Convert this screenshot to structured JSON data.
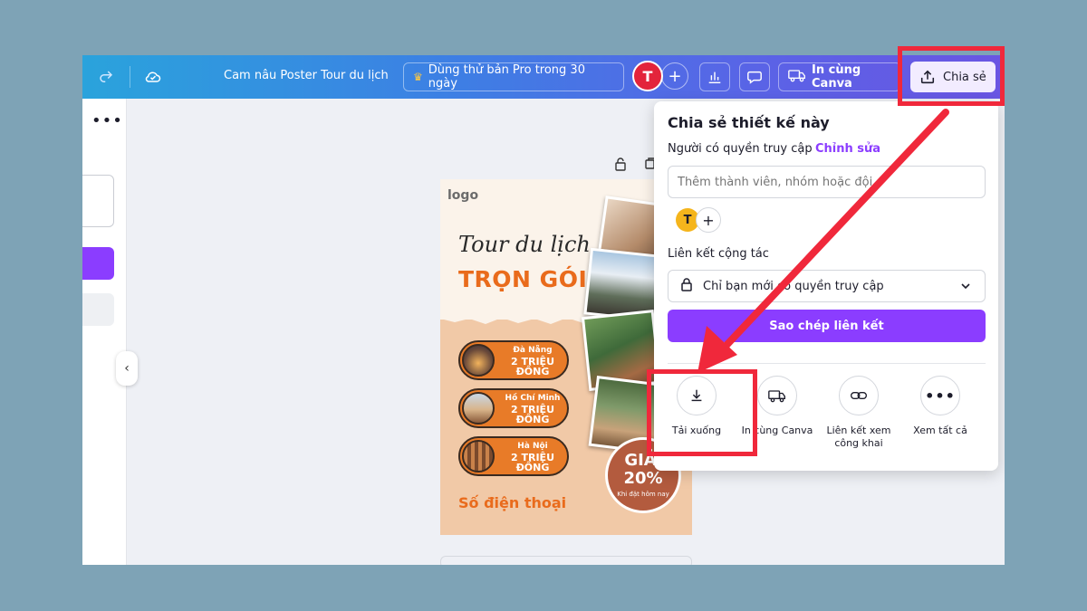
{
  "topbar": {
    "doc_title": "Cam nâu Poster Tour du lịch",
    "pro_trial": "Dùng thử bản Pro trong 30 ngày",
    "avatar_initial": "T",
    "add_symbol": "+",
    "print_label": "In cùng Canva",
    "share_label": "Chia sẻ"
  },
  "left_panel": {
    "more_symbol": "•••",
    "collapse_symbol": "‹"
  },
  "poster": {
    "logo": "logo",
    "headline_script": "Tour du lịch",
    "headline_bold": "TRỌN GÓI",
    "destinations": [
      {
        "city": "Đà Nẵng",
        "price": "2 TRIỆU ĐỒNG"
      },
      {
        "city": "Hồ Chí Minh",
        "price": "2 TRIỆU ĐỒNG"
      },
      {
        "city": "Hà Nội",
        "price": "2 TRIỆU ĐỒNG"
      }
    ],
    "sale_word": "GIẢM",
    "sale_percent": "20%",
    "sale_note": "Khi đặt hôm nay",
    "phone": "Số điện thoại"
  },
  "share_popup": {
    "title": "Chia sẻ thiết kế này",
    "access_label": "Người có quyền truy cập",
    "edit_link": "Chỉnh sửa",
    "member_placeholder": "Thêm thành viên, nhóm hoặc đội",
    "member_avatar": "T",
    "member_add": "+",
    "collab_label": "Liên kết cộng tác",
    "access_option": "Chỉ bạn mới có quyền truy cập",
    "copy_button": "Sao chép liên kết",
    "actions": [
      {
        "label": "Tải xuống",
        "icon": "download-icon"
      },
      {
        "label": "In cùng Canva",
        "icon": "truck-icon"
      },
      {
        "label": "Liên kết xem công khai",
        "icon": "link-icon"
      },
      {
        "label": "Xem tất cả",
        "icon": "more-icon"
      }
    ]
  },
  "colors": {
    "accent_purple": "#8b3dff",
    "annotation_red": "#f0283b",
    "avatar_red": "#e3243b",
    "poster_orange": "#e96b1c"
  }
}
